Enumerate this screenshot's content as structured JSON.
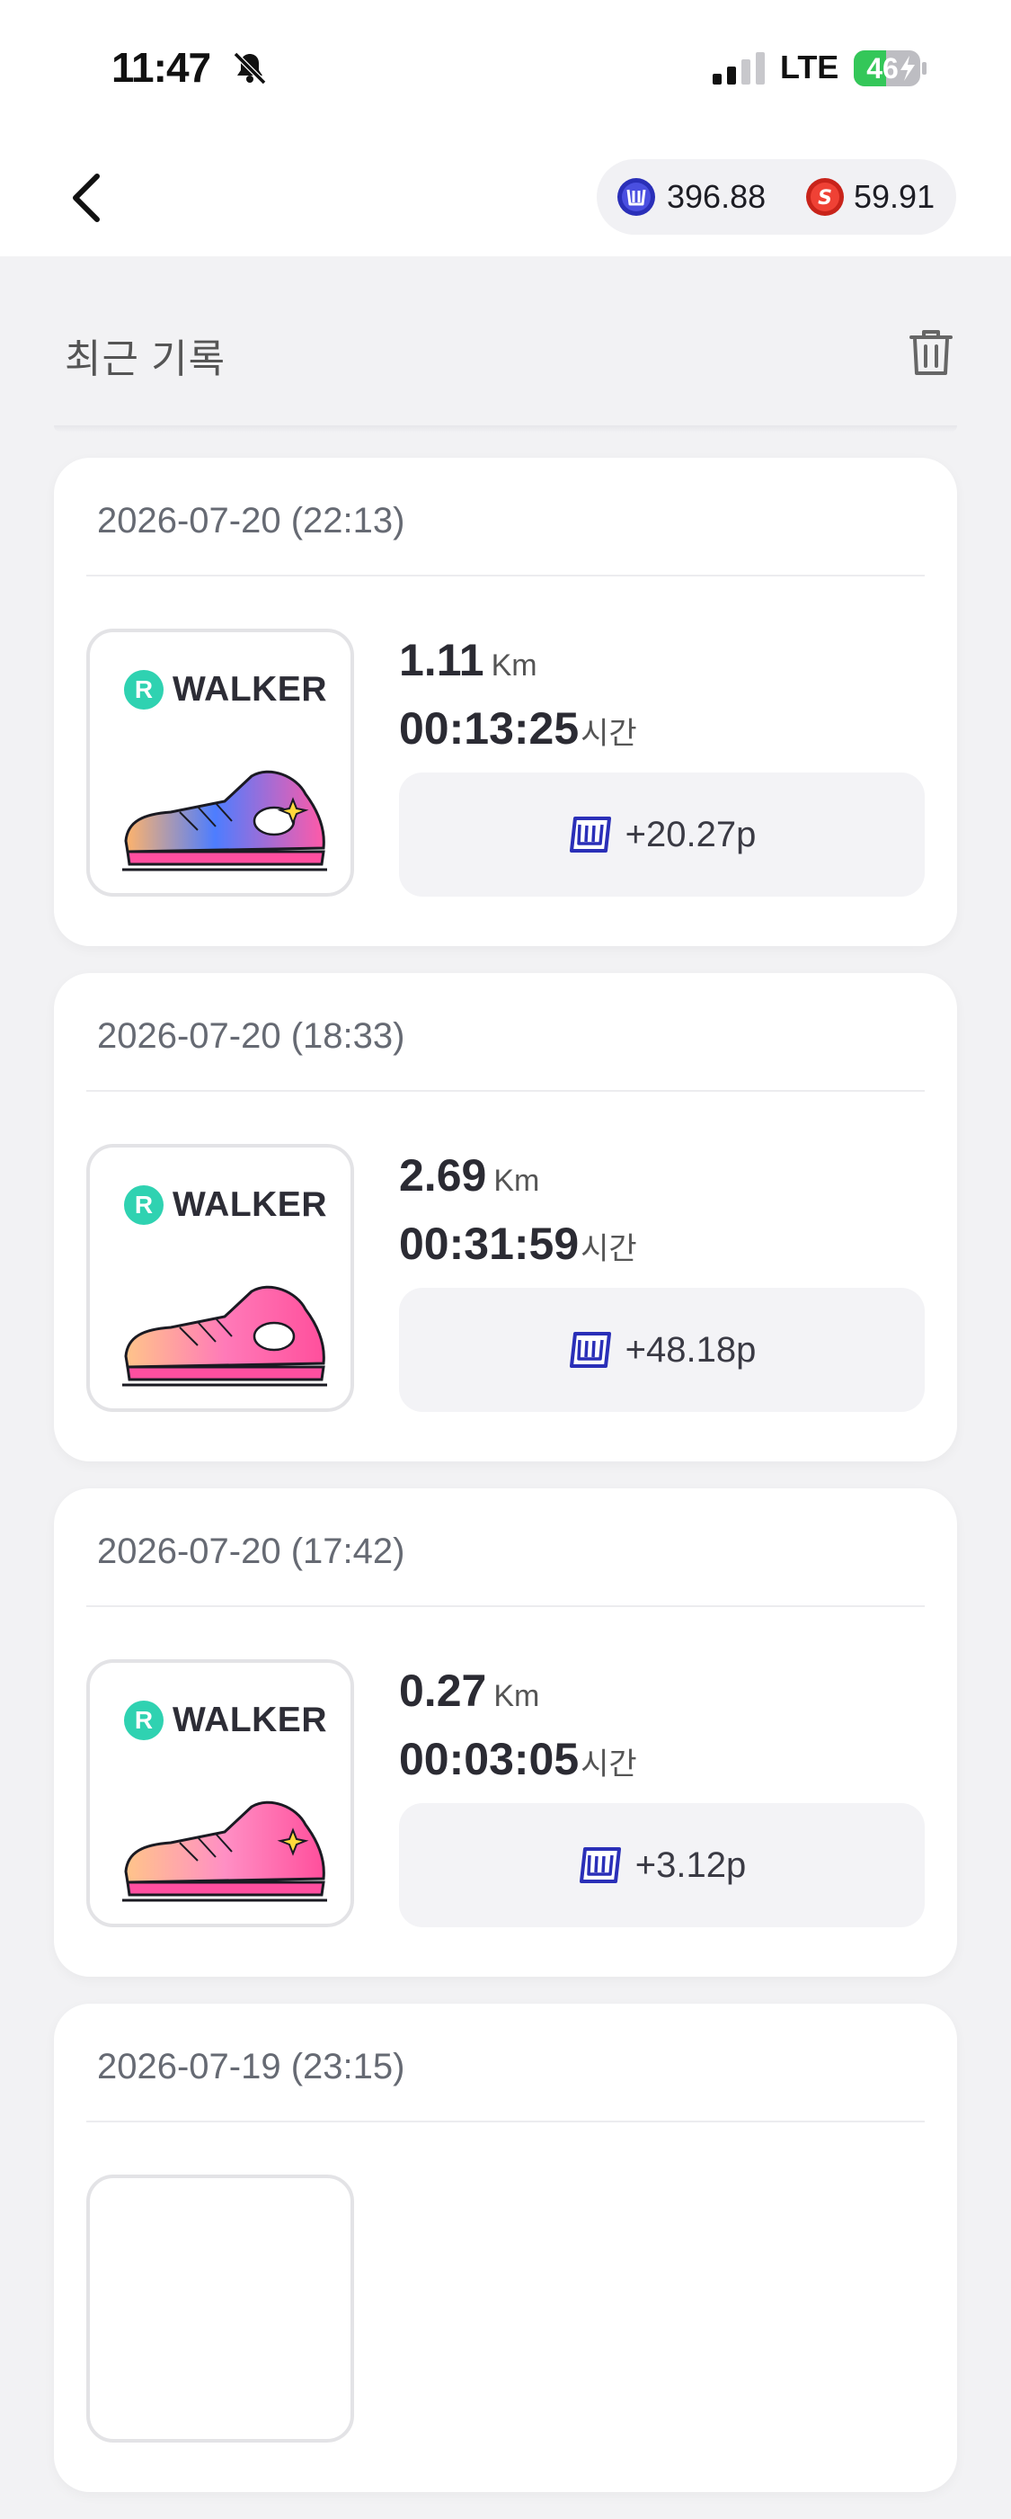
{
  "status": {
    "time": "11:47",
    "network": "LTE",
    "battery": "46"
  },
  "header": {
    "balances": [
      {
        "currency": "W",
        "value": "396.88"
      },
      {
        "currency": "S",
        "value": "59.91"
      }
    ]
  },
  "section": {
    "title": "최근 기록"
  },
  "records": [
    {
      "date": "2026-07-20 (22:13)",
      "brand": "WALKER",
      "distance": "1.11",
      "distance_unit": "Km",
      "duration": "00:13:25",
      "duration_unit": "시간",
      "reward": "+20.27p"
    },
    {
      "date": "2026-07-20 (18:33)",
      "brand": "WALKER",
      "distance": "2.69",
      "distance_unit": "Km",
      "duration": "00:31:59",
      "duration_unit": "시간",
      "reward": "+48.18p"
    },
    {
      "date": "2026-07-20 (17:42)",
      "brand": "WALKER",
      "distance": "0.27",
      "distance_unit": "Km",
      "duration": "00:03:05",
      "duration_unit": "시간",
      "reward": "+3.12p"
    },
    {
      "date": "2026-07-19 (23:15)",
      "brand": "",
      "distance": "",
      "distance_unit": "",
      "duration": "",
      "duration_unit": "",
      "reward": ""
    }
  ],
  "colors": {
    "accent_w": "#3b3fd6",
    "accent_s": "#e23a2e",
    "brand_logo": "#2fd2b1",
    "shoe_pink": "#ff5aa8"
  }
}
